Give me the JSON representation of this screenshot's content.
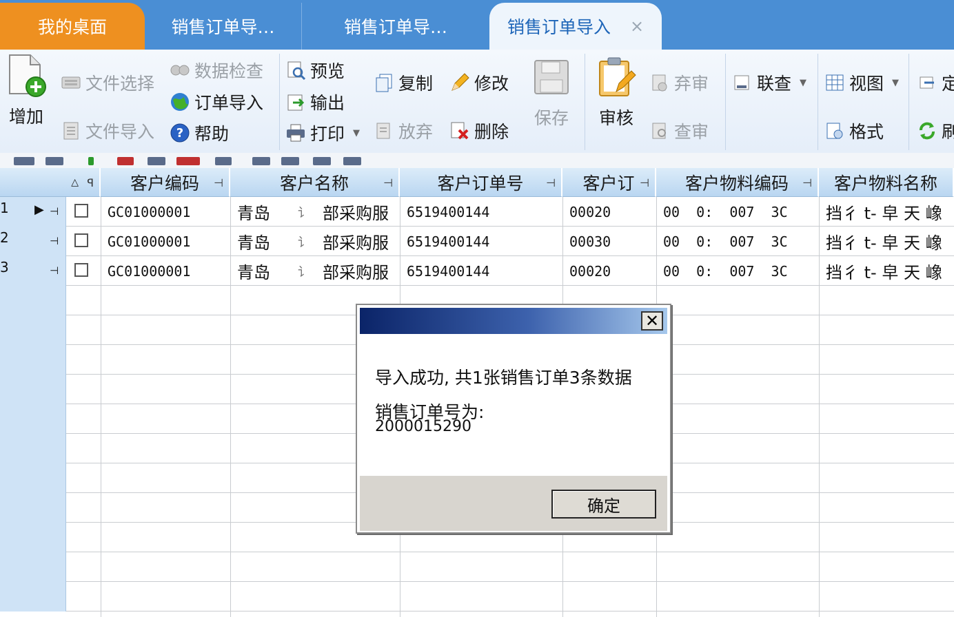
{
  "tabs": [
    {
      "label": "我的桌面"
    },
    {
      "label": "销售订单导…"
    },
    {
      "label": "销售订单导…"
    },
    {
      "label": "销售订单导入",
      "close": "×"
    }
  ],
  "toolbar": {
    "add": "增加",
    "file_select": "文件选择",
    "file_import": "文件导入",
    "data_check": "数据检查",
    "order_import": "订单导入",
    "help": "帮助",
    "preview": "预览",
    "export": "输出",
    "print": "打印",
    "copy": "复制",
    "edit": "修改",
    "abandon": "放弃",
    "delete": "删除",
    "save": "保存",
    "audit": "审核",
    "unaudit": "弃审",
    "check_audit": "查审",
    "link_query": "联查",
    "view": "视图",
    "format": "格式",
    "cut_off_1": "定",
    "cut_off_2": "刷"
  },
  "grid": {
    "columns": [
      "客户编码",
      "客户名称",
      "客户订单号",
      "客户订",
      "客户物料编码",
      "客户物料名称"
    ],
    "rows": [
      {
        "num": "1",
        "customer_code": "GC01000001",
        "customer_name_a": "青岛",
        "customer_name_b": "讠",
        "customer_name_c": "部采购服",
        "order_no": "6519400144",
        "line": "00020",
        "material_code": "00  0:  007  3C",
        "material_name": "挡彳 t- 皁 天 嶑"
      },
      {
        "num": "2",
        "customer_code": "GC01000001",
        "customer_name_a": "青岛",
        "customer_name_b": "讠",
        "customer_name_c": "部采购服",
        "order_no": "6519400144",
        "line": "00030",
        "material_code": "00  0:  007  3C",
        "material_name": "挡彳 t- 皁 天 嶑"
      },
      {
        "num": "3",
        "customer_code": "GC01000001",
        "customer_name_a": "青岛",
        "customer_name_b": "讠",
        "customer_name_c": "部采购服",
        "order_no": "6519400144",
        "line": "00020",
        "material_code": "00  0:  007  3C",
        "material_name": "挡彳 t- 皁 天 嶑"
      }
    ]
  },
  "dialog": {
    "message": "导入成功, 共1张销售订单3条数据",
    "label": "销售订单号为:",
    "order_number": "2000015290",
    "ok": "确定",
    "close": "✕"
  },
  "colors": {
    "tab_bar": "#4a8ed4",
    "home_tab": "#ee9020",
    "active_tab_text": "#1d65b8",
    "grid_header": "#c9e0f5",
    "dialog_title_start": "#0b2468",
    "dialog_title_end": "#a6c8ec"
  }
}
